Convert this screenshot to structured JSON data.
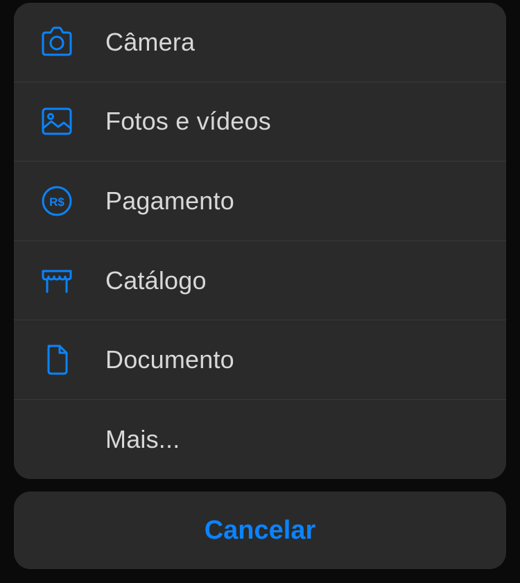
{
  "colors": {
    "accent": "#0a84ff",
    "text": "#d8d8d8",
    "sheet_bg": "#2a2a2a",
    "divider": "#3a3a3a"
  },
  "menu": {
    "items": [
      {
        "label": "Câmera",
        "icon": "camera-icon"
      },
      {
        "label": "Fotos e vídeos",
        "icon": "image-icon"
      },
      {
        "label": "Pagamento",
        "icon": "payment-brl-icon"
      },
      {
        "label": "Catálogo",
        "icon": "storefront-icon"
      },
      {
        "label": "Documento",
        "icon": "document-icon"
      },
      {
        "label": "Mais...",
        "icon": null
      }
    ]
  },
  "cancel": {
    "label": "Cancelar"
  }
}
